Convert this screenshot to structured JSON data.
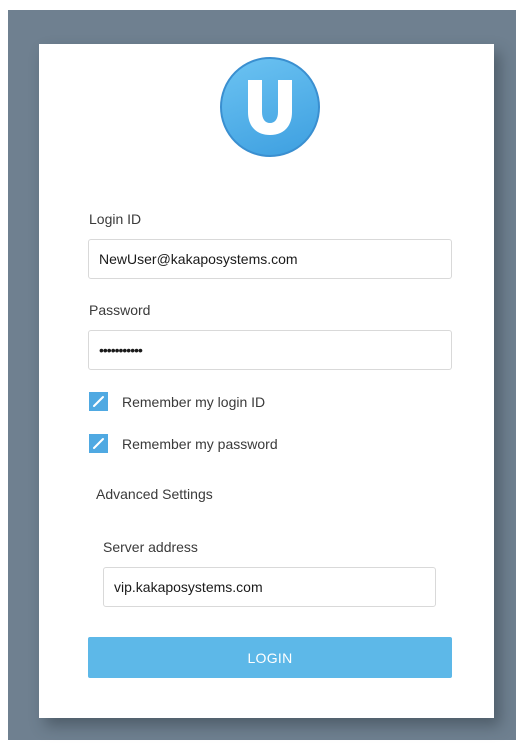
{
  "logo": {
    "icon": "u-letter-logo-icon",
    "letter": "U",
    "color": "#4aaae6"
  },
  "form": {
    "login_id": {
      "label": "Login ID",
      "value": "NewUser@kakaposystems.com"
    },
    "password": {
      "label": "Password",
      "value": "•••••••••••"
    },
    "remember_login": {
      "label": "Remember my login ID",
      "checked": true
    },
    "remember_password": {
      "label": "Remember my password",
      "checked": true
    },
    "advanced_settings": {
      "label": "Advanced Settings"
    },
    "server": {
      "label": "Server address",
      "value": "vip.kakaposystems.com"
    },
    "login_button": {
      "label": "LOGIN",
      "color": "#5db8e8"
    }
  }
}
